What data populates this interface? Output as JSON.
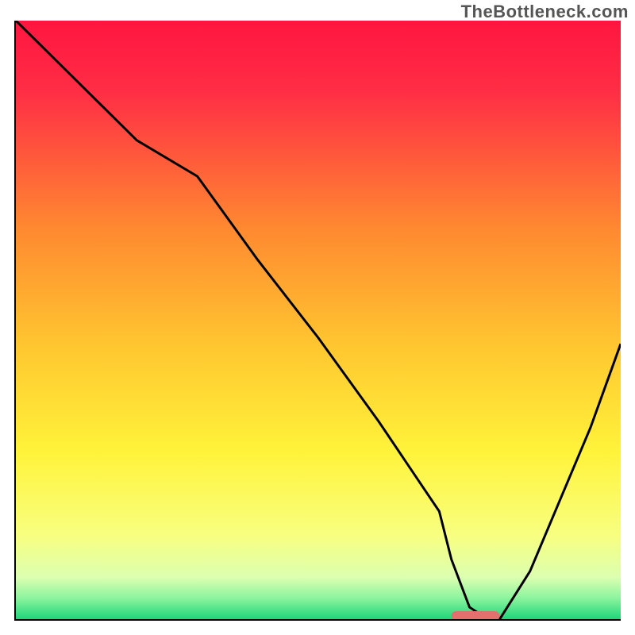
{
  "watermark": "TheBottleneck.com",
  "chart_data": {
    "type": "line",
    "title": "",
    "xlabel": "",
    "ylabel": "",
    "xlim": [
      0,
      100
    ],
    "ylim": [
      0,
      100
    ],
    "grid": false,
    "legend": false,
    "gradient_stops": [
      {
        "offset": 0,
        "color": "#ff1540"
      },
      {
        "offset": 0.12,
        "color": "#ff2e45"
      },
      {
        "offset": 0.35,
        "color": "#ff8a30"
      },
      {
        "offset": 0.55,
        "color": "#ffc830"
      },
      {
        "offset": 0.72,
        "color": "#fff33a"
      },
      {
        "offset": 0.86,
        "color": "#f8ff80"
      },
      {
        "offset": 0.93,
        "color": "#dcffb0"
      },
      {
        "offset": 0.965,
        "color": "#8bf49e"
      },
      {
        "offset": 1.0,
        "color": "#1fd67a"
      }
    ],
    "series": [
      {
        "name": "bottleneck-curve",
        "x": [
          0,
          10,
          20,
          30,
          40,
          50,
          60,
          70,
          72,
          75,
          78,
          80,
          85,
          90,
          95,
          100
        ],
        "y": [
          100,
          90,
          80,
          74,
          60,
          47,
          33,
          18,
          10,
          2,
          0,
          0,
          8,
          20,
          32,
          46
        ]
      }
    ],
    "marker": {
      "name": "optimal-range",
      "x_start": 72,
      "x_end": 80,
      "y": 0,
      "color": "#e2706e"
    },
    "notes": "No numeric axis ticks or labels are present in the source image; xlim/ylim and data values are normalized 0–100 estimates read from curve position relative to the plot frame."
  }
}
